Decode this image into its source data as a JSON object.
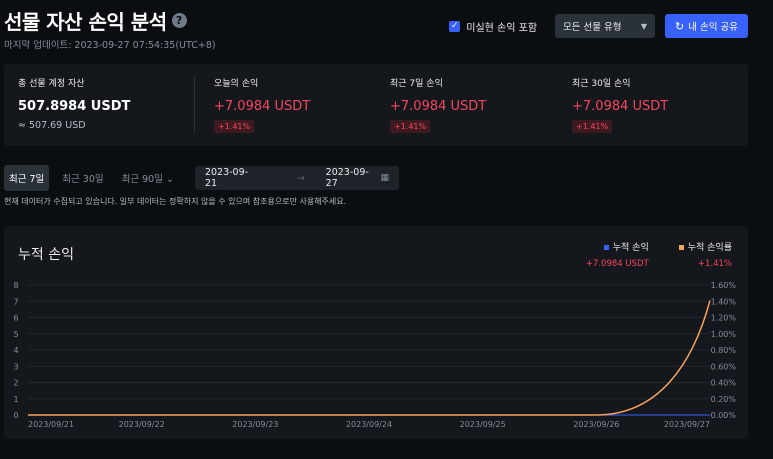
{
  "header": {
    "title": "선물 자산 손익 분석",
    "help_icon": "?",
    "updated": "마지막 업데이트: 2023-09-27 07:54:35(UTC+8)",
    "checkbox_label": "미실현 손익 포함",
    "checkbox_checked": true,
    "select_value": "모든 선물 유형",
    "share_label": "내 손익 공유"
  },
  "stats": {
    "total": {
      "label": "총 선물 계정 자산",
      "value": "507.8984 USDT",
      "approx": "≈ 507.69 USD"
    },
    "today": {
      "label": "오늘의 손익",
      "value": "+7.0984 USDT",
      "pct": "+1.41%"
    },
    "d7": {
      "label": "최근 7일 손익",
      "value": "+7.0984 USDT",
      "pct": "+1.41%"
    },
    "d30": {
      "label": "최근 30일 손익",
      "value": "+7.0984 USDT",
      "pct": "+1.41%"
    }
  },
  "range": {
    "tabs": [
      "최근 7일",
      "최근 30일",
      "최근 90일 ⌄"
    ],
    "active": 0,
    "start": "2023-09-21",
    "end": "2023-09-27",
    "arrow": "→",
    "note": "현재 데이터가 수집되고 있습니다. 일부 데이터는 정확하지 않을 수 있으며 참조용으로만 사용해주세요."
  },
  "chart": {
    "title": "누적 손익",
    "legend": [
      {
        "name": "누적 손익",
        "value": "+7.0984 USDT",
        "color": "#3861fb"
      },
      {
        "name": "누적 손익률",
        "value": "+1.41%",
        "color": "#f7a35c"
      }
    ]
  },
  "chart_data": {
    "type": "line",
    "x": [
      "2023/09/21",
      "2023/09/22",
      "2023/09/23",
      "2023/09/24",
      "2023/09/25",
      "2023/09/26",
      "2023/09/27"
    ],
    "y_left_ticks": [
      "0",
      "1",
      "2",
      "3",
      "4",
      "5",
      "6",
      "7",
      "8"
    ],
    "y_right_ticks": [
      "0.00%",
      "0.20%",
      "0.40%",
      "0.60%",
      "0.80%",
      "1.00%",
      "1.20%",
      "1.40%",
      "1.60%"
    ],
    "ylim_left": [
      0,
      8
    ],
    "ylim_right": [
      0,
      1.6
    ],
    "series": [
      {
        "name": "누적 손익",
        "axis": "left",
        "values": [
          0,
          0,
          0,
          0,
          0,
          0,
          0
        ]
      },
      {
        "name": "누적 손익률",
        "axis": "right",
        "values": [
          0,
          0,
          0,
          0,
          0,
          0,
          1.41
        ]
      }
    ],
    "grid": true,
    "legend_position": "top-right"
  }
}
